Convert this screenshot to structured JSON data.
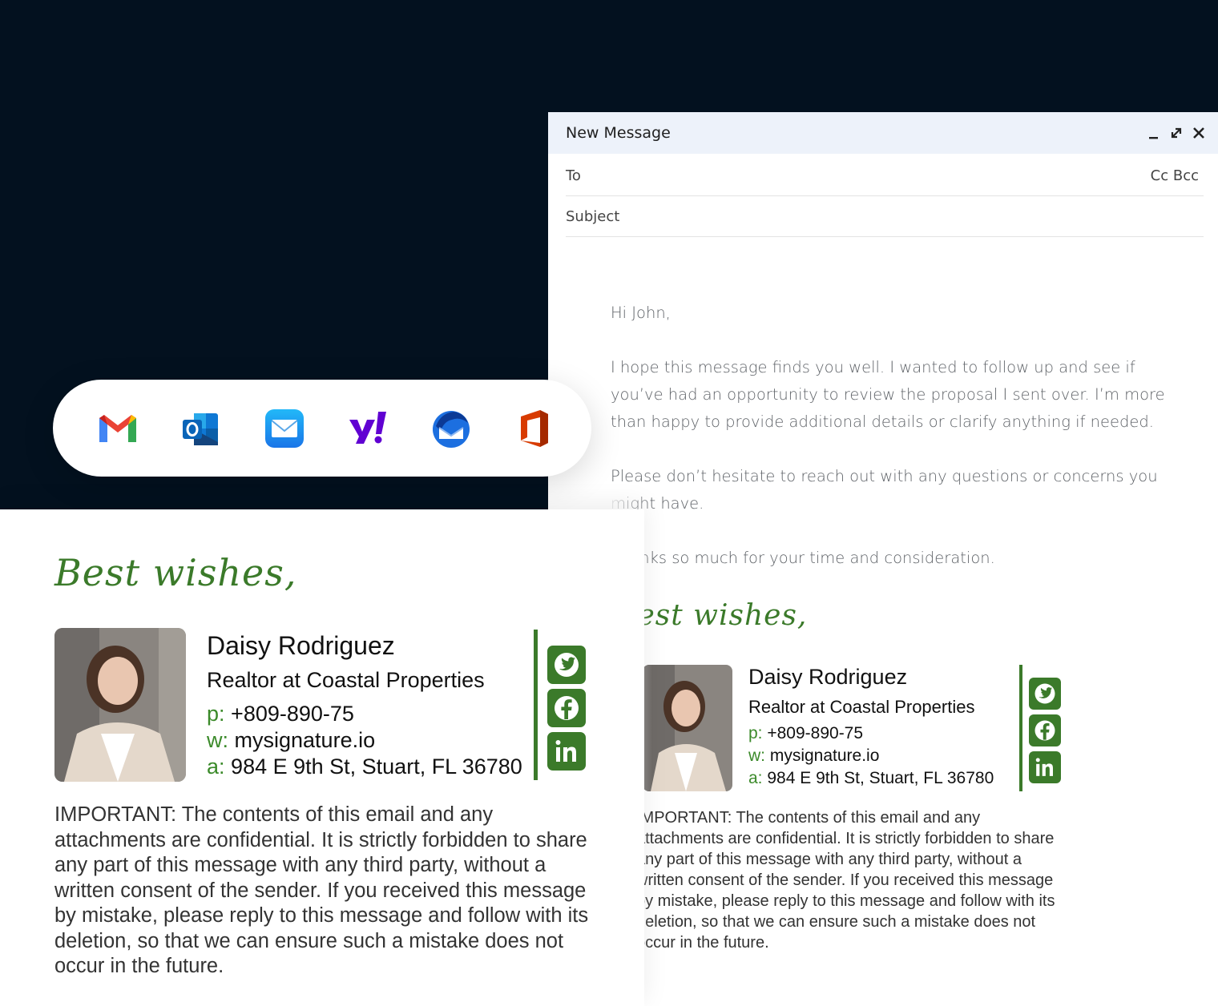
{
  "compose": {
    "title": "New Message",
    "to_label": "To",
    "cc_label": "Cc",
    "bcc_label": "Bcc",
    "subject_label": "Subject",
    "greeting": "Hi John,",
    "paragraph1": "I hope this message finds you well. I wanted to follow up and see if you’ve had an opportunity to review the proposal I sent over. I’m more than happy to provide additional details or clarify anything if needed.",
    "paragraph2": "Please don’t hesitate to reach out with any questions or concerns you might have.",
    "paragraph3": "Thanks so much for your time and consideration."
  },
  "apps": [
    {
      "name": "gmail-icon"
    },
    {
      "name": "outlook-icon"
    },
    {
      "name": "apple-mail-icon"
    },
    {
      "name": "yahoo-icon"
    },
    {
      "name": "thunderbird-icon"
    },
    {
      "name": "office-icon"
    }
  ],
  "signature": {
    "closing": "Best wishes,",
    "name": "Daisy Rodriguez",
    "role": "Realtor at Coastal Properties",
    "phone_label": "p:",
    "phone": "+809-890-75",
    "web_label": "w:",
    "web": "mysignature.io",
    "address_label": "a:",
    "address": "984 E 9th St, Stuart, FL 36780",
    "disclaimer": "IMPORTANT: The contents of this email and any attachments are confidential. It is strictly forbidden to share any part of this message with any third party, without a written consent of the sender. If you received this message by mistake, please reply to this message and follow with its deletion, so that we can ensure such a mistake does not occur in the future.",
    "accent_color": "#3b7a2a",
    "social": [
      "twitter-icon",
      "facebook-icon",
      "linkedin-icon"
    ]
  }
}
